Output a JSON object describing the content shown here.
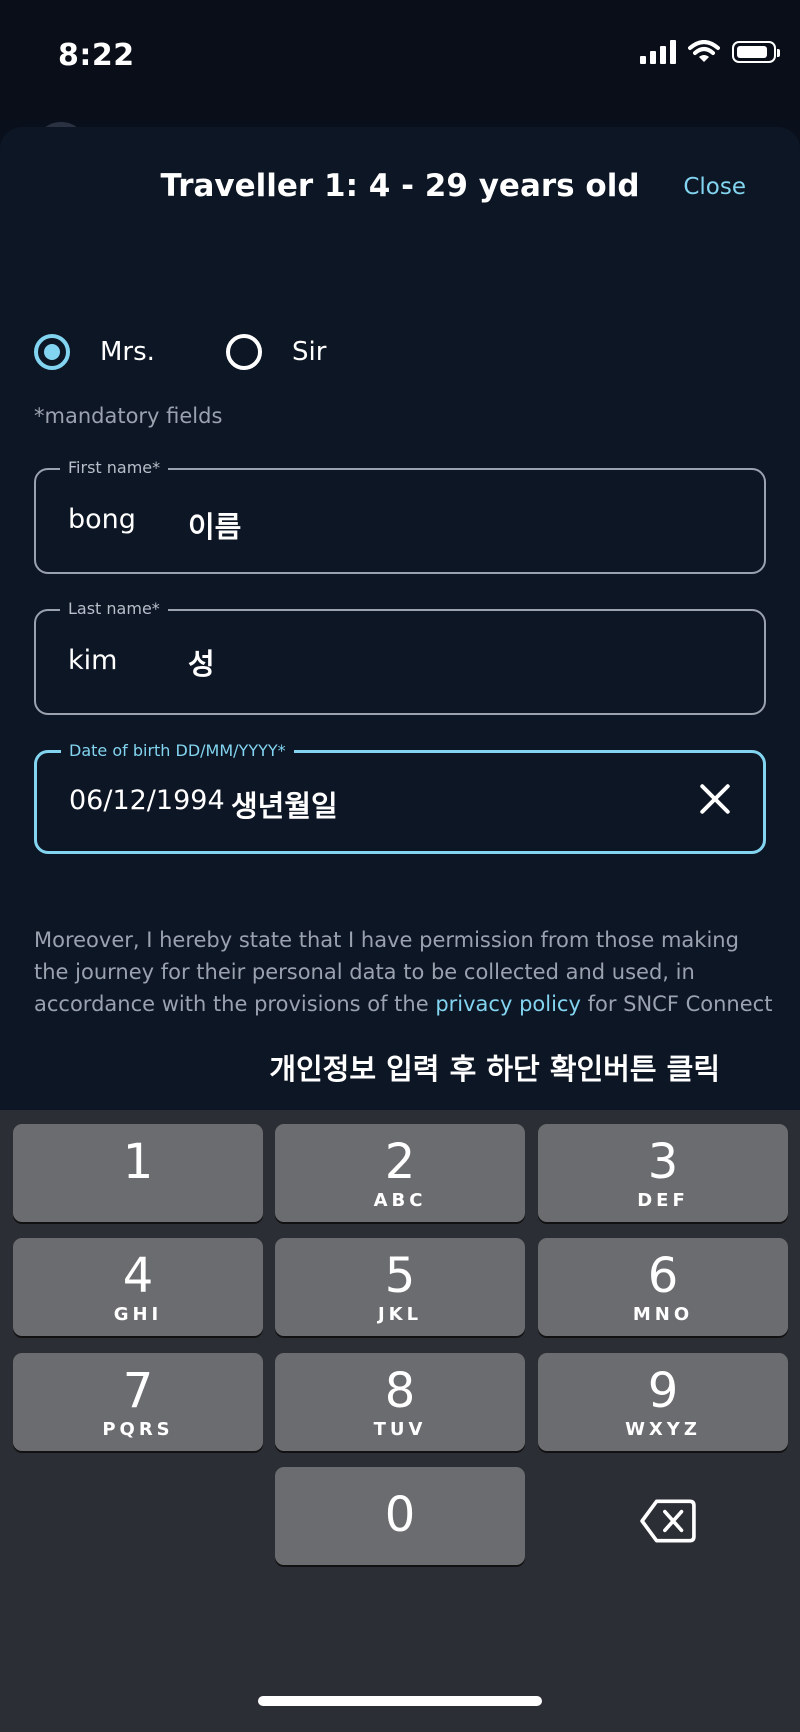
{
  "status_bar": {
    "time": "8:22"
  },
  "header": {
    "title": "Traveller 1: 4 - 29 years old",
    "close_label": "Close"
  },
  "title_options": [
    {
      "label": "Mrs.",
      "selected": true
    },
    {
      "label": "Sir",
      "selected": false
    }
  ],
  "mandatory_note": "*mandatory fields",
  "fields": {
    "first_name": {
      "label": "First name*",
      "value": "bong",
      "annotation": "이름"
    },
    "last_name": {
      "label": "Last name*",
      "value": "kim",
      "annotation": "성"
    },
    "dob": {
      "label": "Date of birth DD/MM/YYYY*",
      "value": "06/12/1994",
      "annotation": "생년월일"
    }
  },
  "consent": {
    "text_before": "Moreover, I hereby state that I have permission from those making the journey for their personal data to be collected and used, in accordance with the provisions of the",
    "link_text": "privacy policy",
    "text_after": "for SNCF Connect"
  },
  "instruction": "개인정보 입력 후 하단 확인버튼 클릭",
  "keypad": [
    {
      "digit": "1",
      "letters": ""
    },
    {
      "digit": "2",
      "letters": "ABC"
    },
    {
      "digit": "3",
      "letters": "DEF"
    },
    {
      "digit": "4",
      "letters": "GHI"
    },
    {
      "digit": "5",
      "letters": "JKL"
    },
    {
      "digit": "6",
      "letters": "MNO"
    },
    {
      "digit": "7",
      "letters": "PQRS"
    },
    {
      "digit": "8",
      "letters": "TUV"
    },
    {
      "digit": "9",
      "letters": "WXYZ"
    },
    {
      "digit": "0",
      "letters": ""
    }
  ],
  "icons": {
    "delete": "backspace-icon",
    "clear": "clear-x-icon",
    "wifi": "wifi-icon",
    "signal": "cellular-signal-icon",
    "battery": "battery-icon"
  },
  "colors": {
    "accent": "#82d4f0",
    "background": "#0d1624",
    "key": "#6b6c70",
    "keyboard": "#2b2e34"
  }
}
